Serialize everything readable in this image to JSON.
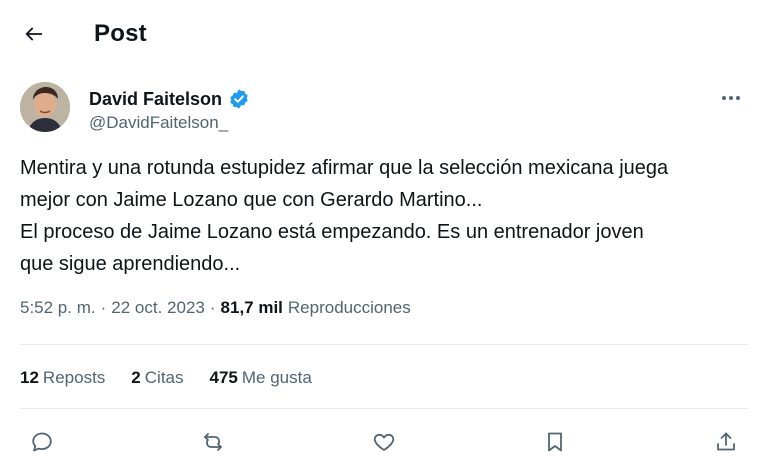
{
  "header": {
    "title": "Post"
  },
  "author": {
    "name": "David Faitelson",
    "handle": "@DavidFaitelson_",
    "verified": true
  },
  "tweet": {
    "lines": [
      "Mentira y una rotunda estupidez afirmar que la selección mexicana juega",
      "mejor con Jaime Lozano que con Gerardo Martino...",
      "El proceso de Jaime Lozano está empezando. Es un entrenador joven",
      "que sigue aprendiendo..."
    ]
  },
  "meta": {
    "time": "5:52 p. m.",
    "separator": "·",
    "date": "22 oct. 2023",
    "views_count": "81,7 mil",
    "views_label": "Reproducciones"
  },
  "stats": {
    "reposts_count": "12",
    "reposts_label": "Reposts",
    "quotes_count": "2",
    "quotes_label": "Citas",
    "likes_count": "475",
    "likes_label": "Me gusta"
  },
  "colors": {
    "verified_badge": "#1d9bf0",
    "secondary_text": "#536471",
    "primary_text": "#0f1419",
    "divider": "#e6ecf0"
  },
  "icons": {
    "back": "arrow-left-icon",
    "verified": "verified-badge-icon",
    "more": "more-dots-icon",
    "reply": "reply-icon",
    "repost": "repost-icon",
    "like": "heart-icon",
    "bookmark": "bookmark-icon",
    "share": "share-icon"
  }
}
